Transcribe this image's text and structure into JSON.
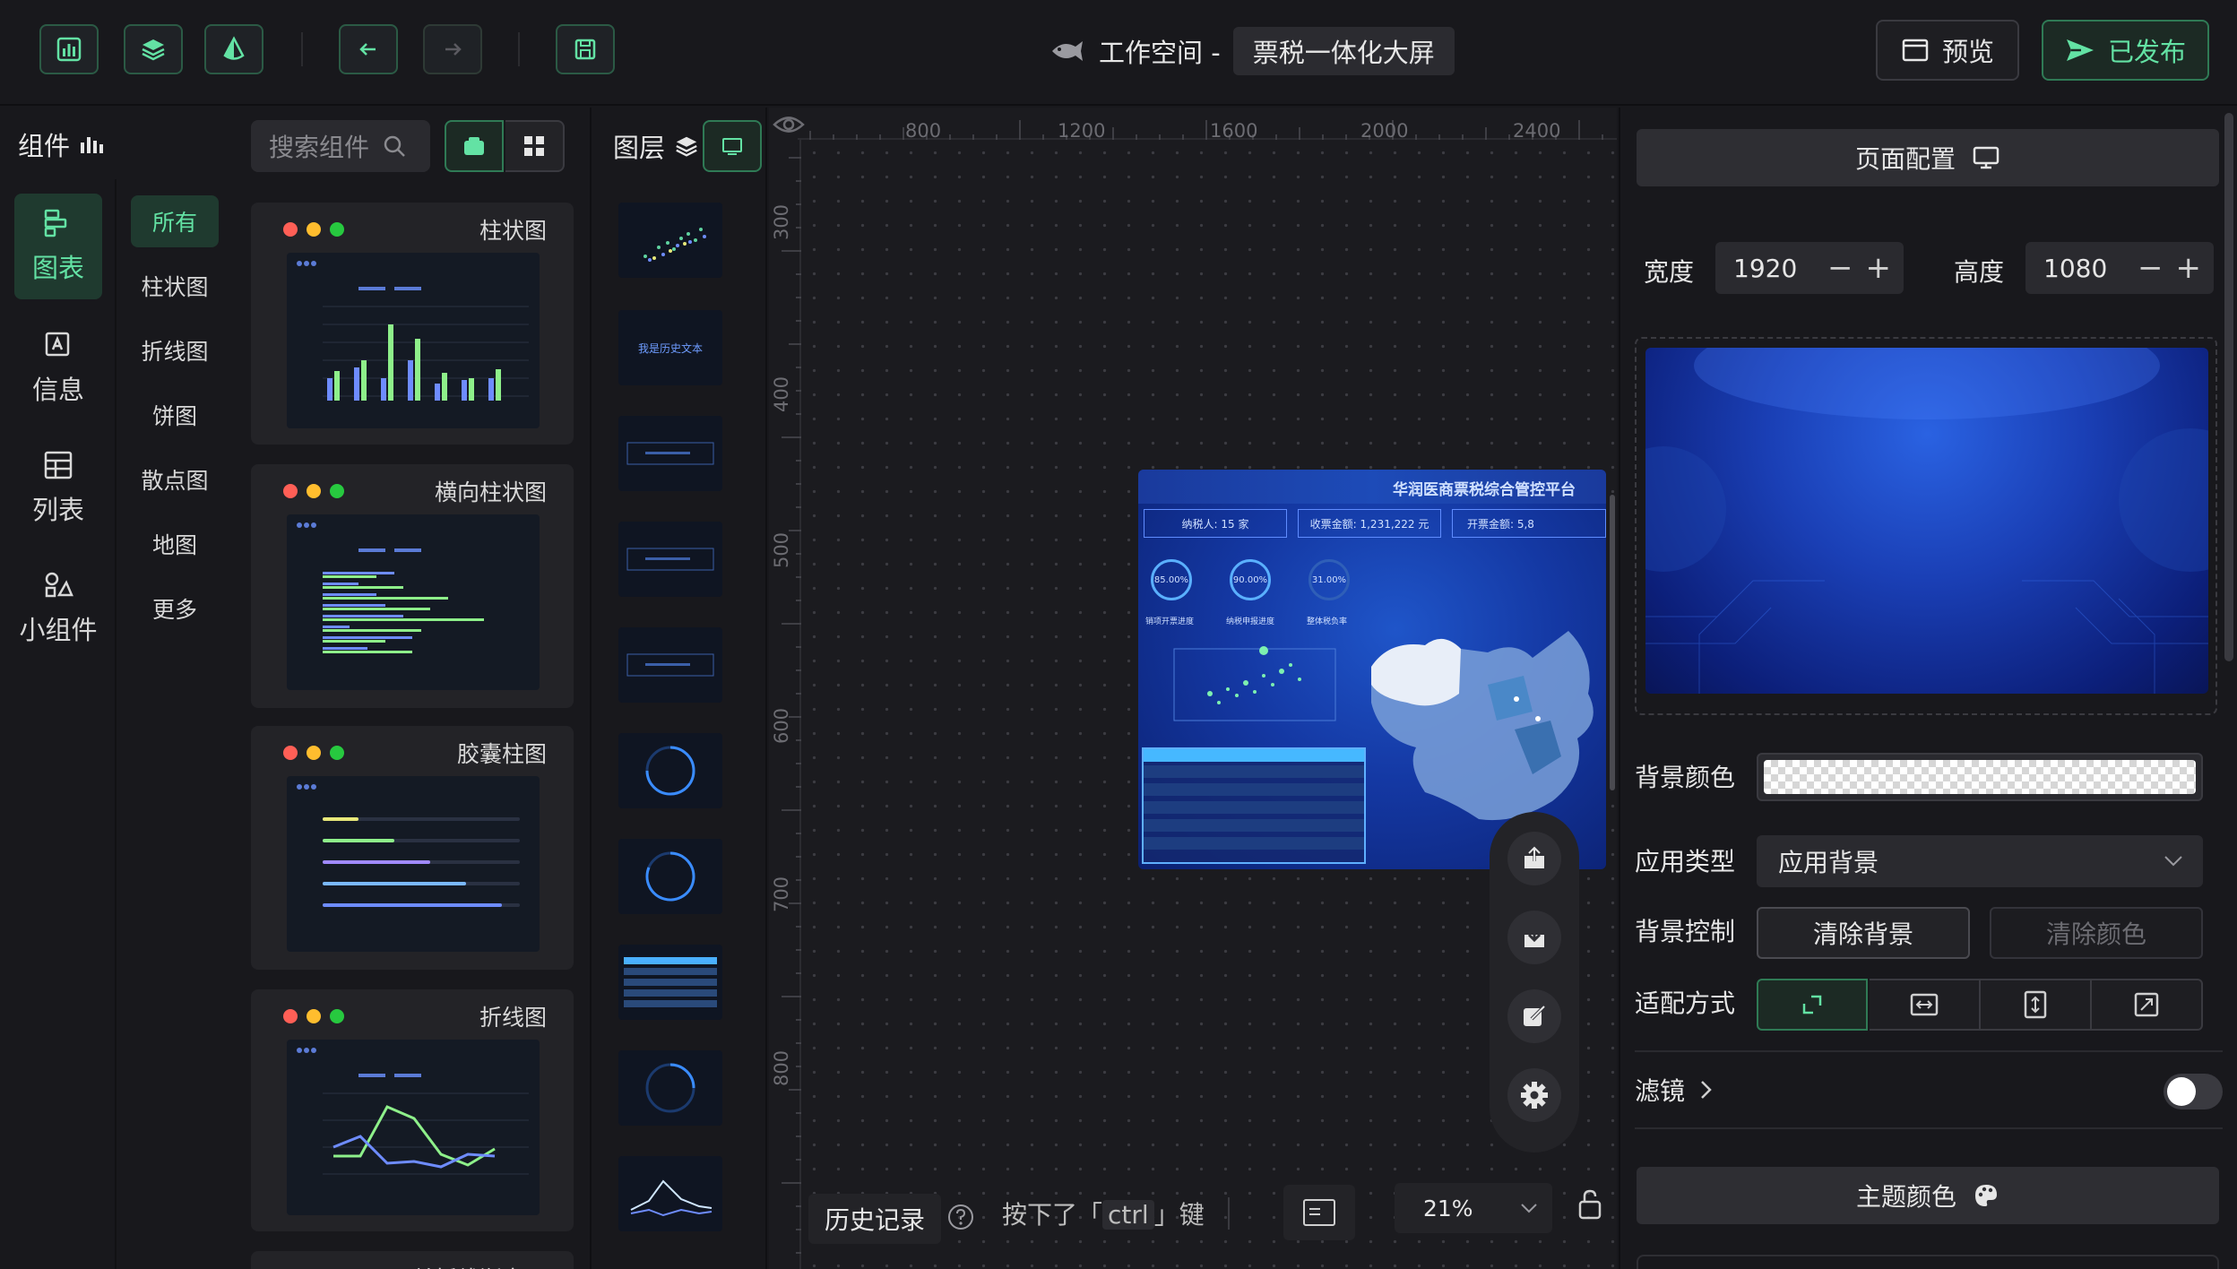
{
  "topbar": {
    "workspace_label": "工作空间 -",
    "project_name": "票税一体化大屏",
    "preview_label": "预览",
    "publish_label": "已发布",
    "icons": [
      "bar-chart-icon",
      "layers-icon",
      "drop-icon",
      "arrow-left-icon",
      "arrow-right-icon",
      "save-icon"
    ]
  },
  "components": {
    "title": "组件",
    "search_placeholder": "搜索组件",
    "categories": [
      {
        "label": "图表",
        "icon": "chart-icon",
        "active": true
      },
      {
        "label": "信息",
        "icon": "text-icon",
        "active": false
      },
      {
        "label": "列表",
        "icon": "table-icon",
        "active": false
      },
      {
        "label": "小组件",
        "icon": "widget-icon",
        "active": false
      }
    ],
    "subcategories": [
      {
        "label": "所有",
        "active": true
      },
      {
        "label": "柱状图"
      },
      {
        "label": "折线图"
      },
      {
        "label": "饼图"
      },
      {
        "label": "散点图"
      },
      {
        "label": "地图"
      },
      {
        "label": "更多"
      }
    ],
    "cards": [
      {
        "title": "柱状图"
      },
      {
        "title": "横向柱状图"
      },
      {
        "title": "胶囊柱图"
      },
      {
        "title": "折线图"
      },
      {
        "title": "单折线渐变图"
      }
    ]
  },
  "layers": {
    "title": "图层",
    "thumb_text": "我是历史文本"
  },
  "canvas": {
    "ruler_top": [
      "800",
      "1200",
      "1600",
      "2000",
      "2400"
    ],
    "ruler_left": [
      "300",
      "400",
      "500",
      "600",
      "700",
      "800"
    ],
    "dashboard": {
      "title": "华润医商票税综合管控平台",
      "stat_1": "纳税人: 15 家",
      "stat_2": "收票金额: 1,231,222 元",
      "stat_3": "开票金额: 5,8",
      "gauges": [
        {
          "value": "85.00%",
          "label": "销项开票进度"
        },
        {
          "value": "90.00%",
          "label": "纳税申报进度"
        },
        {
          "value": "31.00%",
          "label": "整体税负率"
        }
      ]
    },
    "history_label": "历史记录",
    "ctrl_hint_before": "按下了「",
    "ctrl_key": "ctrl",
    "ctrl_hint_after": "」键",
    "zoom": "21%"
  },
  "config": {
    "page_config_label": "页面配置",
    "width_label": "宽度",
    "width_value": "1920",
    "height_label": "高度",
    "height_value": "1080",
    "bg_color_label": "背景颜色",
    "app_type_label": "应用类型",
    "app_type_value": "应用背景",
    "bg_control_label": "背景控制",
    "clear_bg_label": "清除背景",
    "clear_color_label": "清除颜色",
    "fit_label": "适配方式",
    "filter_label": "滤镜",
    "theme_label": "主题颜色",
    "accent": "#63e2a4"
  }
}
